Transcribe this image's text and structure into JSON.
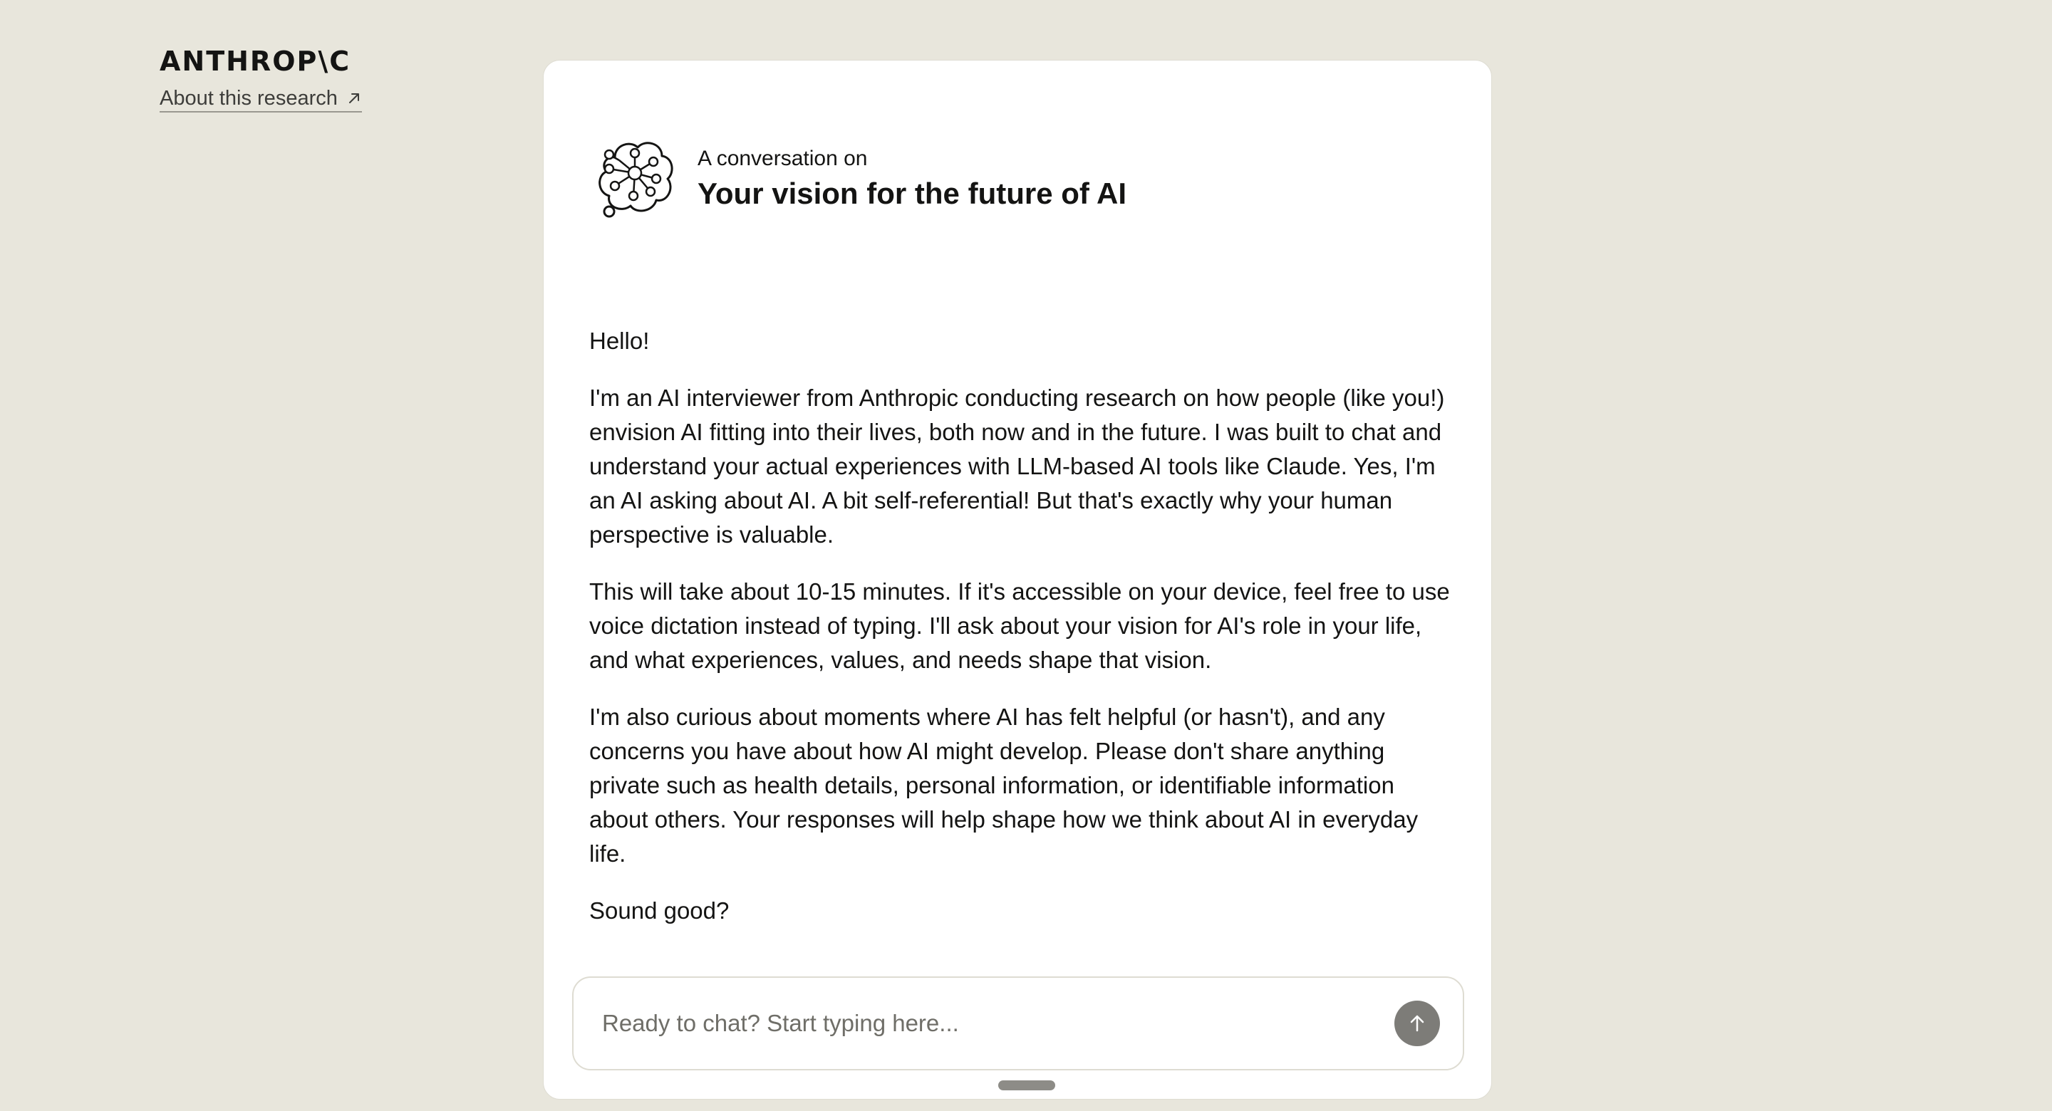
{
  "brand": {
    "logo_text": "ANTHROP\\C",
    "about_link": "About this research"
  },
  "conversation": {
    "kicker": "A conversation on",
    "topic": "Your vision for the future of AI"
  },
  "messages": [
    "Hello!",
    "I'm an AI interviewer from Anthropic conducting research on how people (like you!) envision AI fitting into their lives, both now and in the future. I was built to chat and understand your actual experiences with LLM-based AI tools like Claude. Yes, I'm an AI asking about AI. A bit self-referential! But that's exactly why your human perspective is valuable.",
    "This will take about 10-15 minutes. If it's accessible on your device, feel free to use voice dictation instead of typing. I'll ask about your vision for AI's role in your life, and what experiences, values, and needs shape that vision.",
    "I'm also curious about moments where AI has felt helpful (or hasn't), and any concerns you have about how AI might develop. Please don't share anything private such as health details, personal information, or identifiable information about others. Your responses will help shape how we think about AI in everyday life.",
    "Sound good?"
  ],
  "composer": {
    "value": "",
    "placeholder": "Ready to chat? Start typing here..."
  },
  "icons": {
    "about_arrow": "external-link-arrow-icon",
    "conversation": "network-thought-bubble-icon",
    "send": "arrow-up-icon"
  },
  "colors": {
    "page_background": "#e8e6dc",
    "card_background": "#ffffff",
    "text": "#141413",
    "send_button": "#7d7c78"
  }
}
